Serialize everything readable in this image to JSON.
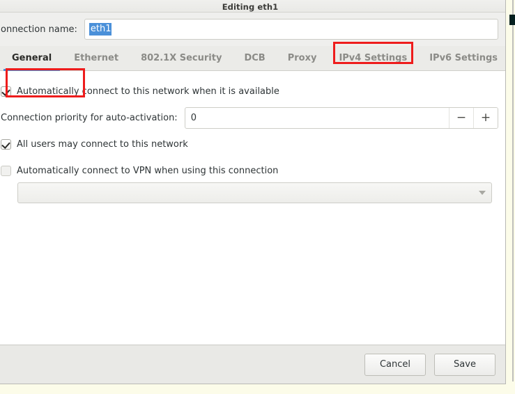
{
  "window": {
    "title": "Editing eth1"
  },
  "connection": {
    "name_label": "onnection name:",
    "name_value": "eth1"
  },
  "tabs": [
    {
      "label": "General",
      "active": true,
      "annotated": false
    },
    {
      "label": "Ethernet",
      "active": false,
      "annotated": false
    },
    {
      "label": "802.1X Security",
      "active": false,
      "annotated": false
    },
    {
      "label": "DCB",
      "active": false,
      "annotated": false
    },
    {
      "label": "Proxy",
      "active": false,
      "annotated": false
    },
    {
      "label": "IPv4 Settings",
      "active": false,
      "annotated": true
    },
    {
      "label": "IPv6 Settings",
      "active": false,
      "annotated": false
    }
  ],
  "general_page": {
    "auto_connect": {
      "label": "Automatically connect to this network when it is available",
      "checked": true
    },
    "priority": {
      "label": "Connection priority for auto-activation:",
      "value": "0",
      "decrement_label": "−",
      "increment_label": "+"
    },
    "all_users": {
      "label": "All users may connect to this network",
      "checked": true
    },
    "auto_vpn": {
      "label": "Automatically connect to VPN when using this connection",
      "checked": false
    },
    "vpn_combo": {
      "value": "",
      "arrow_icon": "chevron-down-icon"
    }
  },
  "actions": {
    "cancel_label": "Cancel",
    "save_label": "Save"
  },
  "annotations": {
    "accent_color": "#ee1c1c",
    "boxes": [
      {
        "name": "auto-connect-checkbox-highlight"
      },
      {
        "name": "ipv4-settings-tab-highlight"
      }
    ]
  },
  "colors": {
    "selection_blue": "#4a90d9",
    "active_tab_underline": "#4a90d9",
    "dialog_bg": "#efefed",
    "page_bg": "#ffffff",
    "backdrop": "#fcfce9"
  }
}
